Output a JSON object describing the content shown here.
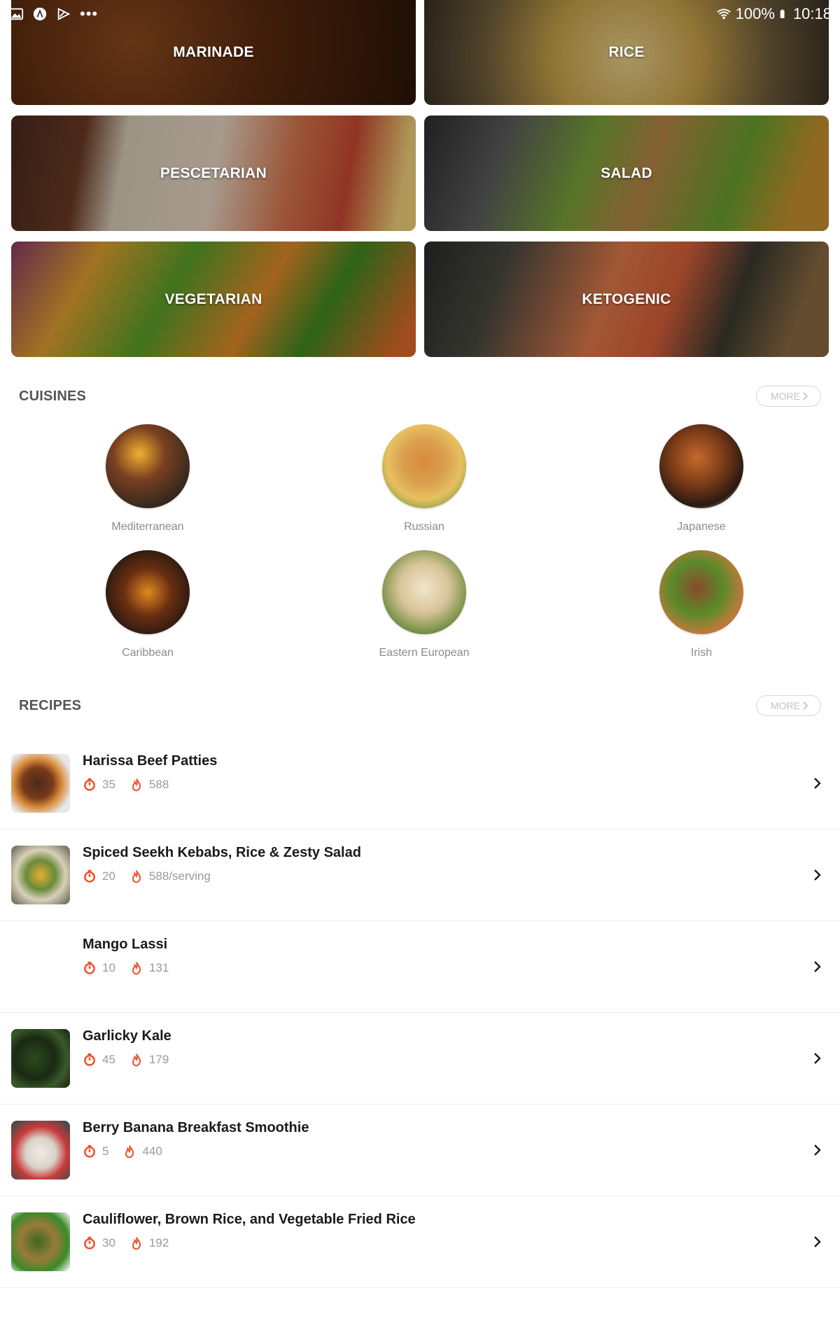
{
  "status_bar": {
    "battery": "100%",
    "time": "10:18",
    "icons": [
      "image-icon",
      "app-icon",
      "play-icon",
      "more-dots-icon",
      "wifi-icon",
      "battery-icon"
    ]
  },
  "categories": [
    {
      "label": "MARINADE"
    },
    {
      "label": "RICE"
    },
    {
      "label": "PESCETARIAN"
    },
    {
      "label": "SALAD"
    },
    {
      "label": "VEGETARIAN"
    },
    {
      "label": "KETOGENIC"
    }
  ],
  "cuisines_section": {
    "title": "CUISINES",
    "more_label": "MORE",
    "items": [
      {
        "name": "Mediterranean"
      },
      {
        "name": "Russian"
      },
      {
        "name": "Japanese"
      },
      {
        "name": "Caribbean"
      },
      {
        "name": "Eastern European"
      },
      {
        "name": "Irish"
      }
    ]
  },
  "recipes_section": {
    "title": "RECIPES",
    "more_label": "MORE",
    "items": [
      {
        "title": "Harissa Beef Patties",
        "time": "35",
        "calories": "588"
      },
      {
        "title": "Spiced Seekh Kebabs, Rice & Zesty Salad",
        "time": "20",
        "calories": "588/serving"
      },
      {
        "title": "Mango Lassi",
        "time": "10",
        "calories": "131"
      },
      {
        "title": "Garlicky Kale",
        "time": "45",
        "calories": "179"
      },
      {
        "title": "Berry Banana Breakfast Smoothie",
        "time": "5",
        "calories": "440"
      },
      {
        "title": "Cauliflower, Brown Rice, and Vegetable Fried Rice",
        "time": "30",
        "calories": "192"
      }
    ]
  },
  "colors": {
    "accent": "#f0502a",
    "section_title": "#555555",
    "muted_text": "#8a8a8a"
  }
}
